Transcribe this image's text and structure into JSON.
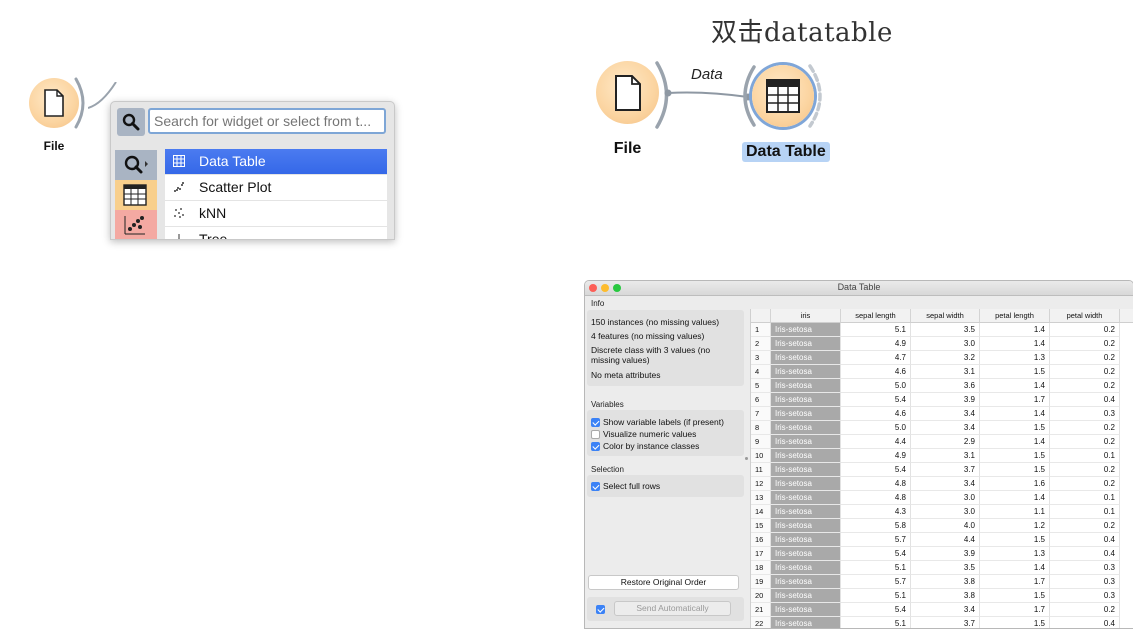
{
  "left_canvas": {
    "file_label": "File",
    "search": {
      "placeholder": "Search for widget or select from t..."
    },
    "categories": [
      "search-icon",
      "data-table-icon",
      "scatter-icon"
    ],
    "suggestions": [
      {
        "label": "Data Table",
        "icon": "table-icon",
        "selected": true
      },
      {
        "label": "Scatter Plot",
        "icon": "scatter-icon",
        "selected": false
      },
      {
        "label": "kNN",
        "icon": "knn-icon",
        "selected": false
      },
      {
        "label": "Tree",
        "icon": "tree-icon",
        "selected": false
      }
    ]
  },
  "right_canvas": {
    "hint": "双击datatable",
    "file_label": "File",
    "link_label": "Data",
    "datatable_label": "Data Table"
  },
  "window": {
    "title": "Data Table",
    "info_label": "Info",
    "info_lines": [
      "150 instances (no missing values)",
      "4 features (no missing values)",
      "Discrete class with 3 values (no missing values)",
      "No meta attributes"
    ],
    "variables_label": "Variables",
    "variables": [
      {
        "label": "Show variable labels (if present)",
        "checked": true
      },
      {
        "label": "Visualize numeric values",
        "checked": false
      },
      {
        "label": "Color by instance classes",
        "checked": true
      }
    ],
    "selection_label": "Selection",
    "selection": {
      "label": "Select full rows",
      "checked": true
    },
    "restore_button": "Restore Original Order",
    "send_auto_button": "Send Automatically",
    "send_auto_checked": true,
    "columns": [
      "iris",
      "sepal length",
      "sepal width",
      "petal length",
      "petal width"
    ],
    "rows": [
      [
        "1",
        "Iris-setosa",
        "5.1",
        "3.5",
        "1.4",
        "0.2"
      ],
      [
        "2",
        "Iris-setosa",
        "4.9",
        "3.0",
        "1.4",
        "0.2"
      ],
      [
        "3",
        "Iris-setosa",
        "4.7",
        "3.2",
        "1.3",
        "0.2"
      ],
      [
        "4",
        "Iris-setosa",
        "4.6",
        "3.1",
        "1.5",
        "0.2"
      ],
      [
        "5",
        "Iris-setosa",
        "5.0",
        "3.6",
        "1.4",
        "0.2"
      ],
      [
        "6",
        "Iris-setosa",
        "5.4",
        "3.9",
        "1.7",
        "0.4"
      ],
      [
        "7",
        "Iris-setosa",
        "4.6",
        "3.4",
        "1.4",
        "0.3"
      ],
      [
        "8",
        "Iris-setosa",
        "5.0",
        "3.4",
        "1.5",
        "0.2"
      ],
      [
        "9",
        "Iris-setosa",
        "4.4",
        "2.9",
        "1.4",
        "0.2"
      ],
      [
        "10",
        "Iris-setosa",
        "4.9",
        "3.1",
        "1.5",
        "0.1"
      ],
      [
        "11",
        "Iris-setosa",
        "5.4",
        "3.7",
        "1.5",
        "0.2"
      ],
      [
        "12",
        "Iris-setosa",
        "4.8",
        "3.4",
        "1.6",
        "0.2"
      ],
      [
        "13",
        "Iris-setosa",
        "4.8",
        "3.0",
        "1.4",
        "0.1"
      ],
      [
        "14",
        "Iris-setosa",
        "4.3",
        "3.0",
        "1.1",
        "0.1"
      ],
      [
        "15",
        "Iris-setosa",
        "5.8",
        "4.0",
        "1.2",
        "0.2"
      ],
      [
        "16",
        "Iris-setosa",
        "5.7",
        "4.4",
        "1.5",
        "0.4"
      ],
      [
        "17",
        "Iris-setosa",
        "5.4",
        "3.9",
        "1.3",
        "0.4"
      ],
      [
        "18",
        "Iris-setosa",
        "5.1",
        "3.5",
        "1.4",
        "0.3"
      ],
      [
        "19",
        "Iris-setosa",
        "5.7",
        "3.8",
        "1.7",
        "0.3"
      ],
      [
        "20",
        "Iris-setosa",
        "5.1",
        "3.8",
        "1.5",
        "0.3"
      ],
      [
        "21",
        "Iris-setosa",
        "5.4",
        "3.4",
        "1.7",
        "0.2"
      ],
      [
        "22",
        "Iris-setosa",
        "5.1",
        "3.7",
        "1.5",
        "0.4"
      ]
    ]
  },
  "colors": {
    "widget_orange": "#fbd4a0",
    "selection_blue": "#3568e8",
    "class_gray": "#a9a9a9",
    "checkbox_blue": "#3b82f6"
  }
}
